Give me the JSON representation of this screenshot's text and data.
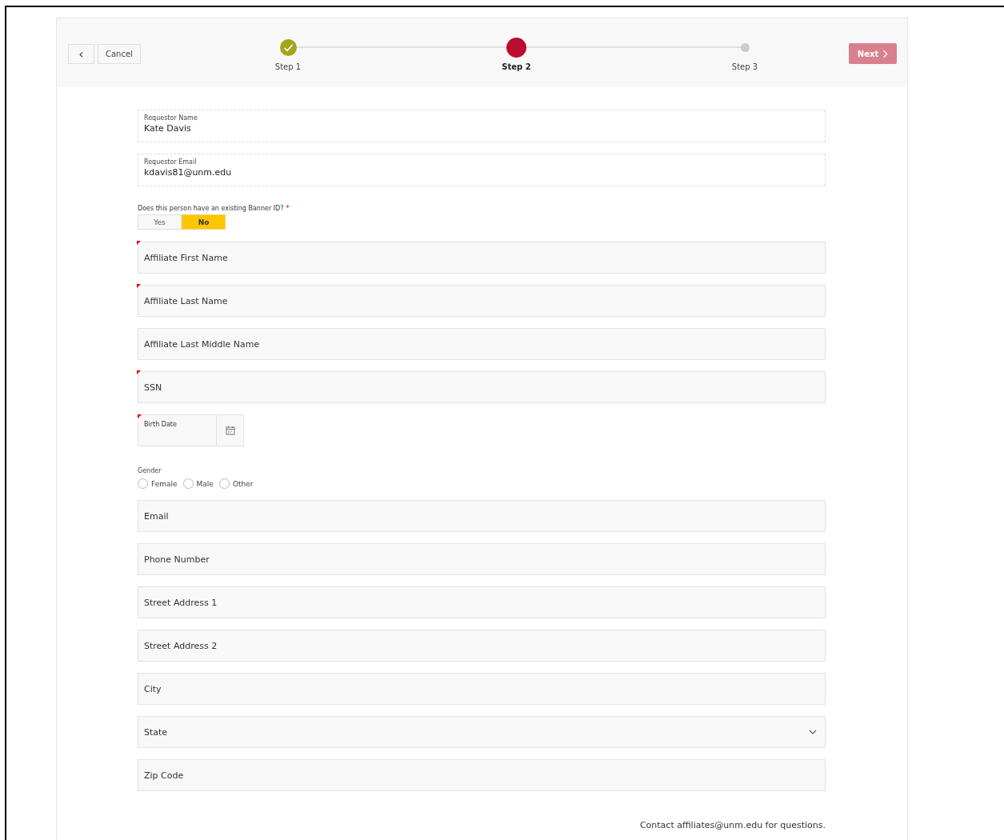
{
  "header": {
    "back_button": "‹",
    "cancel_button": "Cancel",
    "next_button": {
      "label": "Next",
      "disabled": true
    },
    "steps": [
      {
        "label": "Step 1",
        "completed": true,
        "selected": false
      },
      {
        "label": "Step 2",
        "completed": false,
        "selected": true
      },
      {
        "label": "Step 3",
        "completed": false,
        "selected": false
      }
    ]
  },
  "readonly_fields": [
    {
      "label": "Requestor Name",
      "value": "Kate Davis"
    },
    {
      "label": "Requestor Email",
      "value": "kdavis81@unm.edu"
    }
  ],
  "banner_question": {
    "label": "Does this person have an existing Banner ID?",
    "required_mark": "*",
    "options": [
      {
        "label": "Yes",
        "selected": false
      },
      {
        "label": "No",
        "selected": true
      }
    ]
  },
  "fields": [
    {
      "kind": "text",
      "placeholder": "Affiliate First Name",
      "required": true
    },
    {
      "kind": "text",
      "placeholder": "Affiliate Last Name",
      "required": true
    },
    {
      "kind": "text",
      "placeholder": "Affiliate Last Middle Name",
      "required": false
    },
    {
      "kind": "text",
      "placeholder": "SSN",
      "required": true
    },
    {
      "kind": "date",
      "label": "Birth Date",
      "required": true
    },
    {
      "kind": "radio",
      "label": "Gender",
      "options": [
        {
          "label": "Female",
          "selected": false
        },
        {
          "label": "Male",
          "selected": false
        },
        {
          "label": "Other",
          "selected": false
        }
      ]
    },
    {
      "kind": "text",
      "placeholder": "Email",
      "required": false
    },
    {
      "kind": "text",
      "placeholder": "Phone Number",
      "required": false
    },
    {
      "kind": "text",
      "placeholder": "Street Address 1",
      "required": false
    },
    {
      "kind": "text",
      "placeholder": "Street Address 2",
      "required": false
    },
    {
      "kind": "text",
      "placeholder": "City",
      "required": false
    },
    {
      "kind": "select",
      "placeholder": "State",
      "required": false
    },
    {
      "kind": "text",
      "placeholder": "Zip Code",
      "required": false
    }
  ],
  "footer": {
    "text": "Contact affiliates@unm.edu for questions."
  }
}
